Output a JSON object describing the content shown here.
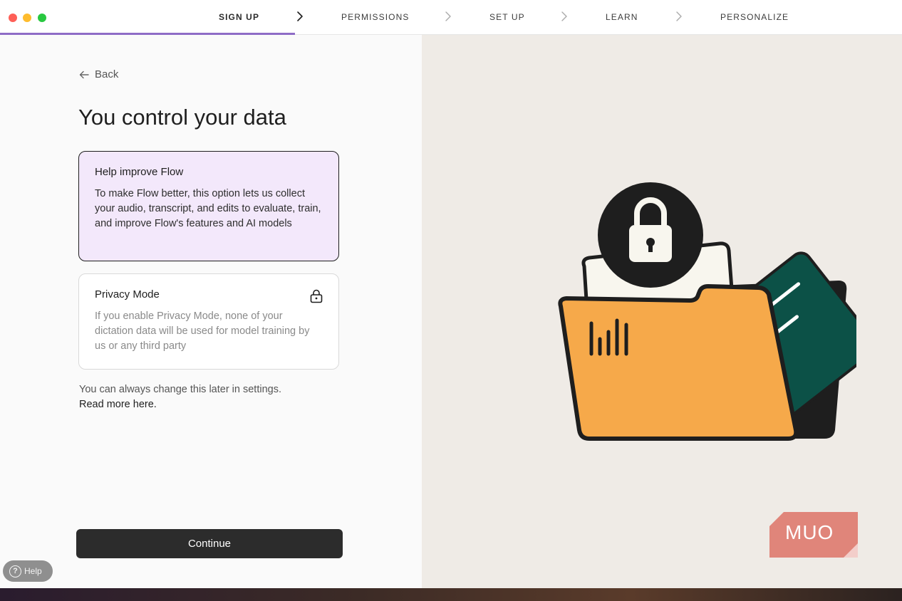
{
  "titlebar": {
    "steps": [
      {
        "label": "SIGN UP",
        "active": true
      },
      {
        "label": "PERMISSIONS",
        "active": false
      },
      {
        "label": "SET UP",
        "active": false
      },
      {
        "label": "LEARN",
        "active": false
      },
      {
        "label": "PERSONALIZE",
        "active": false
      }
    ]
  },
  "left": {
    "back_label": "Back",
    "title": "You control your data",
    "options": [
      {
        "title": "Help improve Flow",
        "description": "To make Flow better, this option lets us collect your audio, transcript, and edits to evaluate, train, and improve Flow's features and AI models",
        "selected": true
      },
      {
        "title": "Privacy Mode",
        "description": "If you enable Privacy Mode, none of your dictation data will be used for model training by us or any third party",
        "selected": false,
        "icon": "lock-icon"
      }
    ],
    "note": "You can always change this later in settings.",
    "note_link": "Read more here.",
    "continue_label": "Continue"
  },
  "help_label": "Help",
  "watermark": "MUO",
  "colors": {
    "accent": "#8e6cc6",
    "selected_card": "#f3e8fb",
    "folder": "#f6a94a",
    "document_green": "#0c5147",
    "watermark": "#e0857a"
  }
}
